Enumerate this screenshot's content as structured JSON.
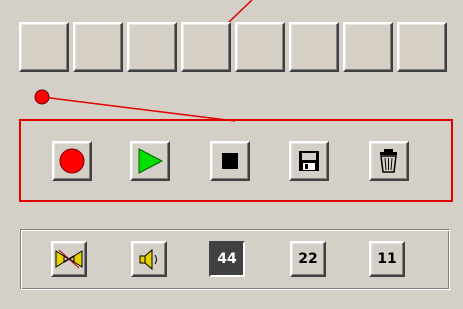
{
  "pad_bank": {
    "pads": [
      "pad-1",
      "pad-2",
      "pad-3",
      "pad-4",
      "pad-5",
      "pad-6",
      "pad-7",
      "pad-8"
    ],
    "highlighted_pad": 4
  },
  "controls": {
    "record": "record-icon",
    "play": "play-icon",
    "stop": "stop-icon",
    "save": "floppy-disk-icon",
    "delete": "trash-can-icon"
  },
  "options": {
    "mixer": "speakers-icon",
    "volume": "speaker-icon",
    "rates": [
      {
        "label": "44",
        "selected": true
      },
      {
        "label": "22",
        "selected": false
      },
      {
        "label": "11",
        "selected": false
      }
    ]
  },
  "colors": {
    "accent": "#e00000",
    "record": "#ff0000",
    "play": "#00e000",
    "face": "#d4d0c8"
  }
}
